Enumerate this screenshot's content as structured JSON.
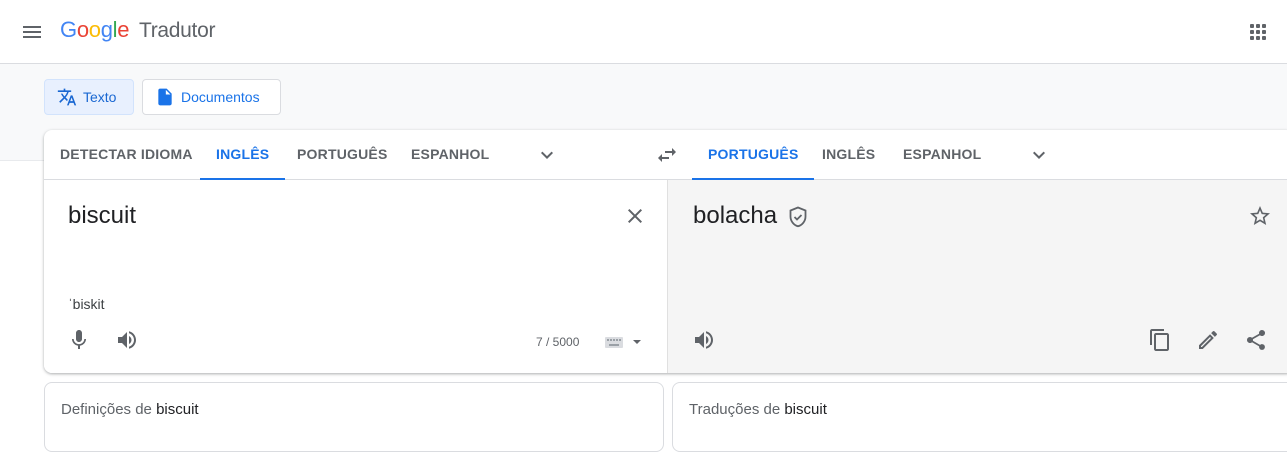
{
  "header": {
    "logo_letters": [
      {
        "ch": "G",
        "color": "#4285f4"
      },
      {
        "ch": "o",
        "color": "#ea4335"
      },
      {
        "ch": "o",
        "color": "#fbbc05"
      },
      {
        "ch": "g",
        "color": "#4285f4"
      },
      {
        "ch": "l",
        "color": "#34a853"
      },
      {
        "ch": "e",
        "color": "#ea4335"
      }
    ],
    "product_name": "Tradutor"
  },
  "modes": {
    "text_label": "Texto",
    "documents_label": "Documentos"
  },
  "source_langs": [
    "DETECTAR IDIOMA",
    "INGLÊS",
    "PORTUGUÊS",
    "ESPANHOL"
  ],
  "target_langs": [
    "PORTUGUÊS",
    "INGLÊS",
    "ESPANHOL"
  ],
  "source": {
    "text": "biscuit",
    "transliteration": "ˈbiskit",
    "char_count": "7 / 5000"
  },
  "target": {
    "text": "bolacha"
  },
  "panels": {
    "definitions_prefix": "Definições de",
    "translations_prefix": "Traduções de",
    "word": "biscuit"
  },
  "colors": {
    "accent": "#1a73e8",
    "icon": "#5f6368"
  }
}
